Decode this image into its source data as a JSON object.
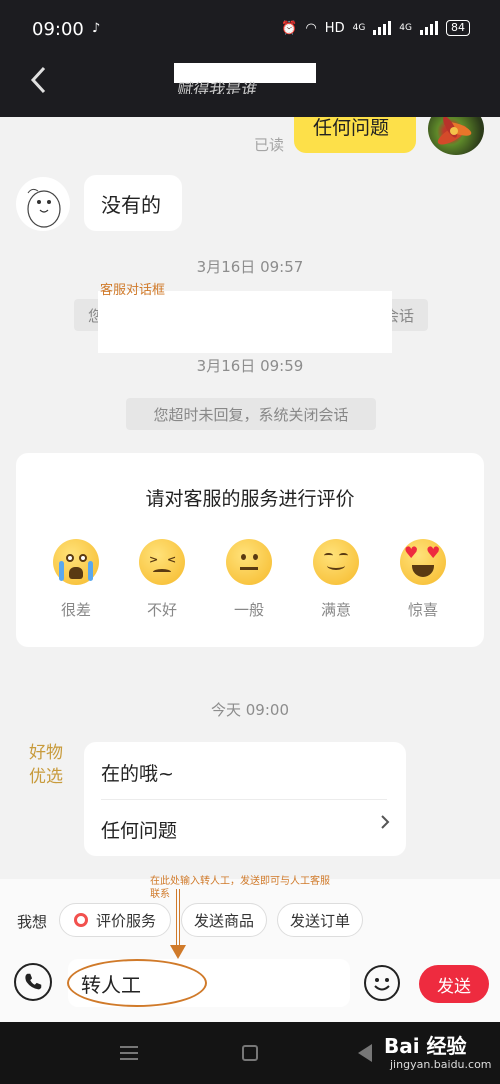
{
  "status_bar": {
    "time": "09:00",
    "network": "HD",
    "signal_1": "4G",
    "signal_2": "4G",
    "battery": "84"
  },
  "header": {
    "title": "赋得我是谁"
  },
  "chat": {
    "read_label": "已读",
    "my_message": "任何问题",
    "agent_message": "没有的",
    "annotation_label": "客服对话框",
    "time_1": "3月16日 09:57",
    "sys_msg_1_left": "您",
    "sys_msg_1_right": "会话",
    "time_2": "3月16日 09:59",
    "sys_msg_2": "您超时未回复，系统关闭会话",
    "rating": {
      "title": "请对客服的服务进行评价",
      "options": [
        {
          "label": "很差",
          "icon": "crying-face-icon"
        },
        {
          "label": "不好",
          "icon": "frowning-face-icon"
        },
        {
          "label": "一般",
          "icon": "neutral-face-icon"
        },
        {
          "label": "满意",
          "icon": "smiling-face-icon"
        },
        {
          "label": "惊喜",
          "icon": "heart-eyes-face-icon"
        }
      ]
    },
    "time_3": "今天 09:00",
    "shop_badge_line1": "好物",
    "shop_badge_line2": "优选",
    "menu": {
      "item_1": "在的哦~",
      "item_2": "任何问题"
    }
  },
  "bottom": {
    "annotation": "在此处输入转人工，发送即可与人工客服联系",
    "want_label": "我想",
    "chips": [
      "评价服务",
      "发送商品",
      "发送订单"
    ],
    "input_value": "转人工",
    "send_label": "发送"
  },
  "nav_bar": {
    "watermark": "Bai 经验",
    "watermark_sub": "jingyan.baidu.com"
  }
}
